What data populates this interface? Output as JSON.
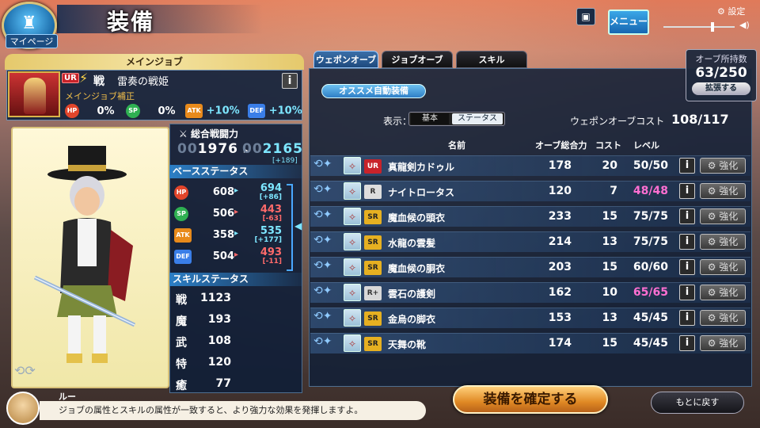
{
  "header": {
    "title": "装備",
    "home_label": "マイページ",
    "menu_label": "メニュー",
    "settings_label": "設定"
  },
  "mainjob": {
    "section_label": "メインジョブ",
    "rarity": "UR",
    "job_class": "戦",
    "job_name": "雷奏の戦姫",
    "bonus_label": "メインジョブ補正",
    "hp_label": "HP",
    "hp_bonus": "0%",
    "sp_label": "SP",
    "sp_bonus": "0%",
    "atk_label": "ATK",
    "atk_bonus": "+10%",
    "def_label": "DEF",
    "def_bonus": "+10%"
  },
  "combat_power": {
    "label": "総合戦闘力",
    "old_prefix": "00",
    "old": "1976",
    "arrow": "▸",
    "new_prefix": "00",
    "new": "2165",
    "diff": "[+189]"
  },
  "base_status": {
    "label": "ベースステータス",
    "rows": [
      {
        "stat": "HP",
        "current": "608",
        "arrow": "▸",
        "next": "694",
        "diff": "[+86]",
        "dir": "up"
      },
      {
        "stat": "SP",
        "current": "506",
        "arrow": "▸",
        "next": "443",
        "diff": "[-63]",
        "dir": "dn"
      },
      {
        "stat": "ATK",
        "current": "358",
        "arrow": "▸",
        "next": "535",
        "diff": "[+177]",
        "dir": "up"
      },
      {
        "stat": "DEF",
        "current": "504",
        "arrow": "▸",
        "next": "493",
        "diff": "[-11]",
        "dir": "dn"
      }
    ]
  },
  "skill_status": {
    "label": "スキルステータス",
    "rows": [
      {
        "key": "戦",
        "value": "1123"
      },
      {
        "key": "魔",
        "value": "193"
      },
      {
        "key": "武",
        "value": "108"
      },
      {
        "key": "特",
        "value": "120"
      },
      {
        "key": "癒",
        "value": "77"
      }
    ]
  },
  "advisor": {
    "name": "ルー",
    "message": "ジョブの属性とスキルの属性が一致すると、より強力な効果を発揮しますよ。"
  },
  "tabs": [
    "ウェポンオーブ",
    "ジョブオーブ",
    "スキル"
  ],
  "orbs_held": {
    "label": "オーブ所持数",
    "value": "63/250",
    "expand_label": "拡張する"
  },
  "auto_equip_label": "オススメ自動装備",
  "display": {
    "label": "表示：",
    "options": [
      "基本",
      "ステータス"
    ]
  },
  "cost": {
    "label": "ウェポンオーブコスト",
    "value": "108/117"
  },
  "table": {
    "headers": [
      "名前",
      "オーブ総合力",
      "コスト",
      "レベル"
    ],
    "rows": [
      {
        "rarity": "UR",
        "name": "真龍剣カドゥル",
        "power": "178",
        "cost": "20",
        "level": "50/50",
        "pink": false
      },
      {
        "rarity": "R",
        "name": "ナイトロータス",
        "power": "120",
        "cost": "7",
        "level": "48/48",
        "pink": true
      },
      {
        "rarity": "SR",
        "name": "魔血候の頭衣",
        "power": "233",
        "cost": "15",
        "level": "75/75",
        "pink": false
      },
      {
        "rarity": "SR",
        "name": "水龍の雲髪",
        "power": "214",
        "cost": "13",
        "level": "75/75",
        "pink": false
      },
      {
        "rarity": "SR",
        "name": "魔血候の胴衣",
        "power": "203",
        "cost": "15",
        "level": "60/60",
        "pink": false
      },
      {
        "rarity": "R+",
        "name": "雲石の護剣",
        "power": "162",
        "cost": "10",
        "level": "65/65",
        "pink": true
      },
      {
        "rarity": "SR",
        "name": "金烏の脚衣",
        "power": "153",
        "cost": "13",
        "level": "45/45",
        "pink": false
      },
      {
        "rarity": "SR",
        "name": "天舞の靴",
        "power": "174",
        "cost": "15",
        "level": "45/45",
        "pink": false
      }
    ],
    "enhance_label": "強化",
    "info_label": "i"
  },
  "confirm_label": "装備を確定する",
  "back_label": "もとに戻す"
}
